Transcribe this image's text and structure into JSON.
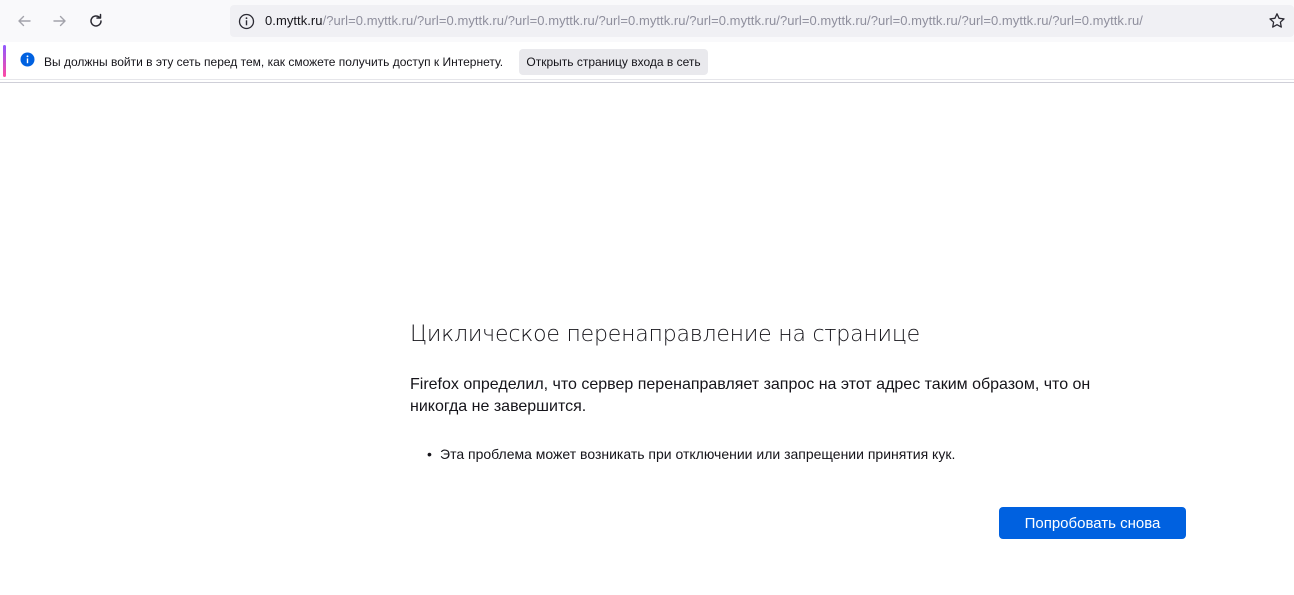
{
  "toolbar": {
    "back_icon": "arrow-left-icon",
    "forward_icon": "arrow-right-icon",
    "reload_icon": "reload-icon",
    "url_host": "0.myttk.ru",
    "url_path": "/?url=0.myttk.ru/?url=0.myttk.ru/?url=0.myttk.ru/?url=0.myttk.ru/?url=0.myttk.ru/?url=0.myttk.ru/?url=0.myttk.ru/?url=0.myttk.ru/?url=0.myttk.ru/",
    "info_icon": "info-icon",
    "bookmark_icon": "star-icon"
  },
  "notification": {
    "icon": "info-circle-icon",
    "message": "Вы должны войти в эту сеть перед тем, как сможете получить доступ к Интернету.",
    "button_label": "Открыть страницу входа в сеть",
    "accent_colors": [
      "#9059ff",
      "#ff4aa2"
    ]
  },
  "error_page": {
    "title": "Циклическое перенаправление на странице",
    "description": "Firefox определил, что сервер перенаправляет запрос на этот адрес таким образом, что он никогда не завершится.",
    "bullets": [
      "Эта проблема может возникать при отключении или запрещении принятия кук."
    ],
    "retry_label": "Попробовать снова",
    "retry_color": "#0061e0"
  }
}
